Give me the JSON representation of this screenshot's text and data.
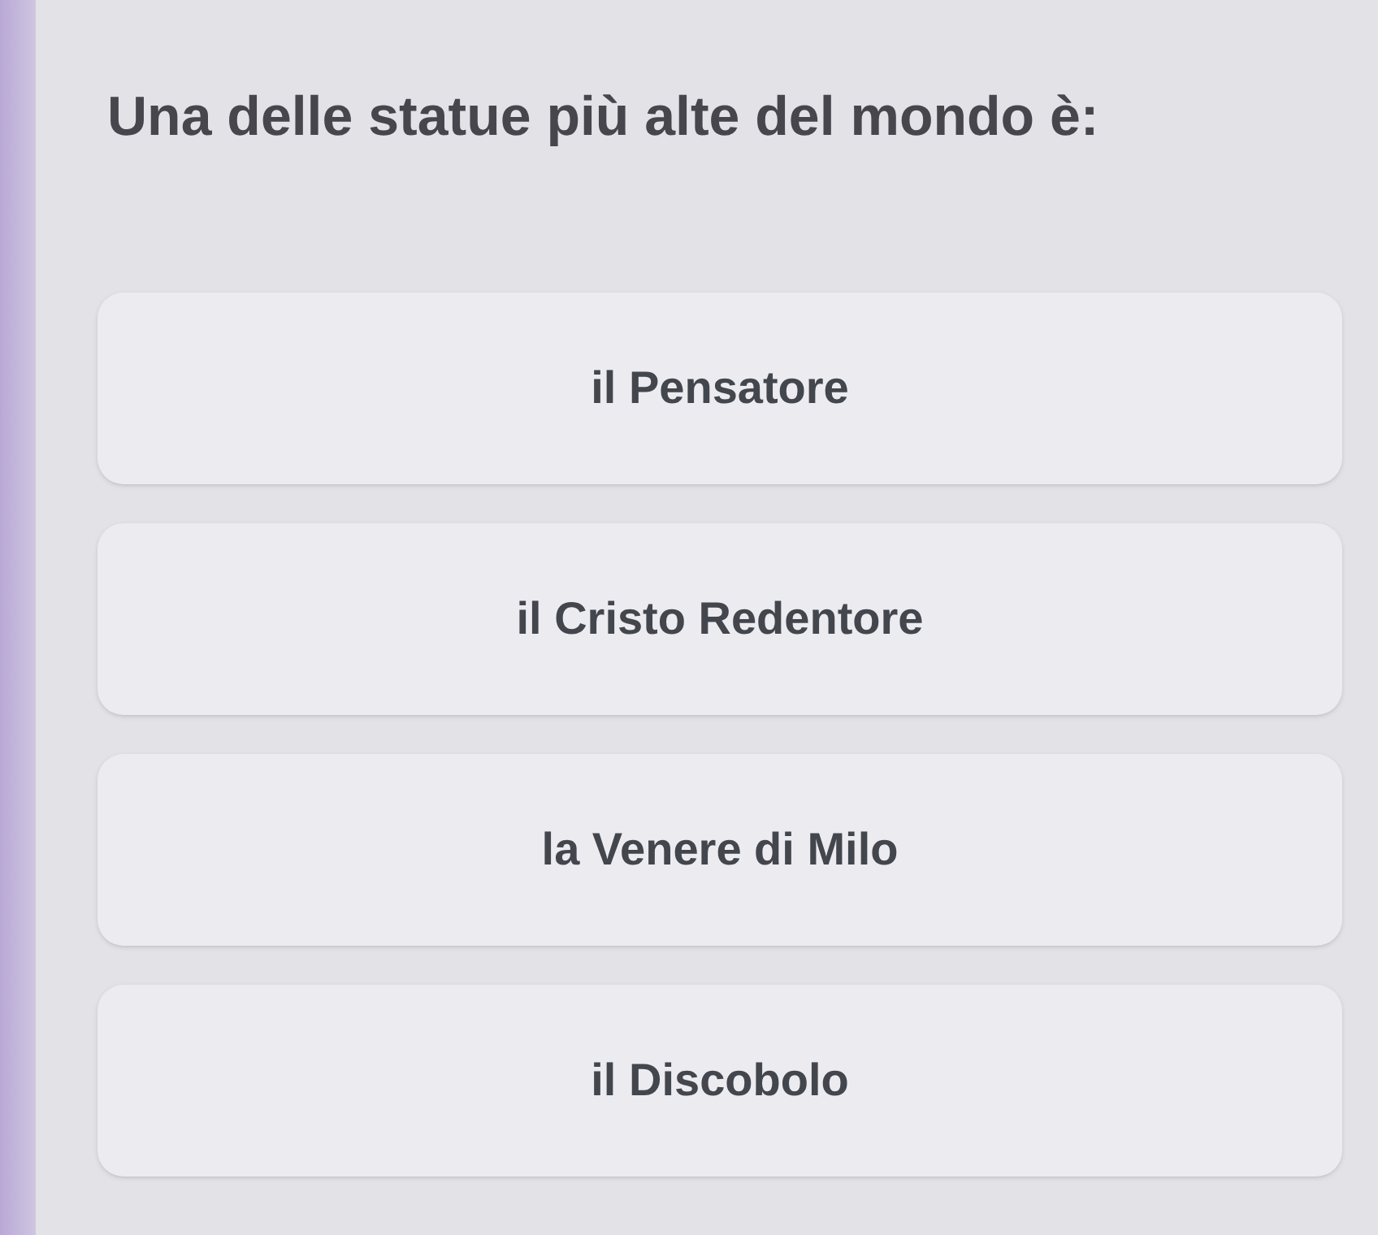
{
  "question": "Una delle statue più alte del mondo è:",
  "options": [
    {
      "label": "il Pensatore",
      "selected": false
    },
    {
      "label": "il Cristo Redentore",
      "selected": false
    },
    {
      "label": "la Venere di Milo",
      "selected": false
    },
    {
      "label": "il Discobolo",
      "selected": false
    }
  ]
}
